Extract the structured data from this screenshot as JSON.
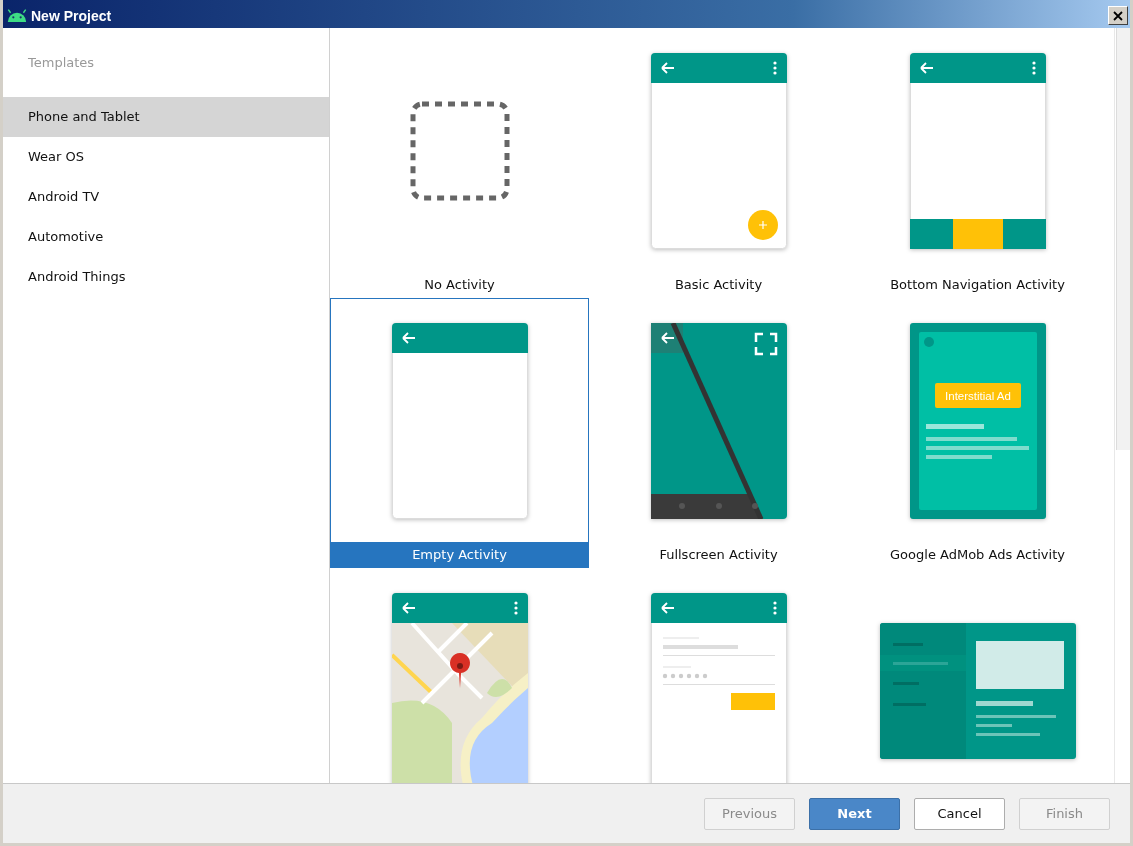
{
  "window": {
    "title": "New Project"
  },
  "sidebar": {
    "heading": "Templates",
    "items": [
      {
        "label": "Phone and Tablet",
        "selected": true
      },
      {
        "label": "Wear OS",
        "selected": false
      },
      {
        "label": "Android TV",
        "selected": false
      },
      {
        "label": "Automotive",
        "selected": false
      },
      {
        "label": "Android Things",
        "selected": false
      }
    ]
  },
  "templates": [
    {
      "kind": "none",
      "label": "No Activity",
      "selected": false
    },
    {
      "kind": "basic",
      "label": "Basic Activity",
      "selected": false
    },
    {
      "kind": "bottom_nav",
      "label": "Bottom Navigation Activity",
      "selected": false
    },
    {
      "kind": "empty",
      "label": "Empty Activity",
      "selected": true
    },
    {
      "kind": "fullscreen",
      "label": "Fullscreen Activity",
      "selected": false
    },
    {
      "kind": "admob",
      "label": "Google AdMob Ads Activity",
      "selected": false,
      "ad_text": "Interstitial Ad"
    },
    {
      "kind": "maps",
      "selected": false
    },
    {
      "kind": "login",
      "selected": false
    },
    {
      "kind": "master_detail",
      "selected": false
    }
  ],
  "buttons": [
    {
      "label": "Previous",
      "disabled": true,
      "primary": false
    },
    {
      "label": "Next",
      "disabled": false,
      "primary": true
    },
    {
      "label": "Cancel",
      "disabled": false,
      "primary": false
    },
    {
      "label": "Finish",
      "disabled": true,
      "primary": false
    }
  ]
}
